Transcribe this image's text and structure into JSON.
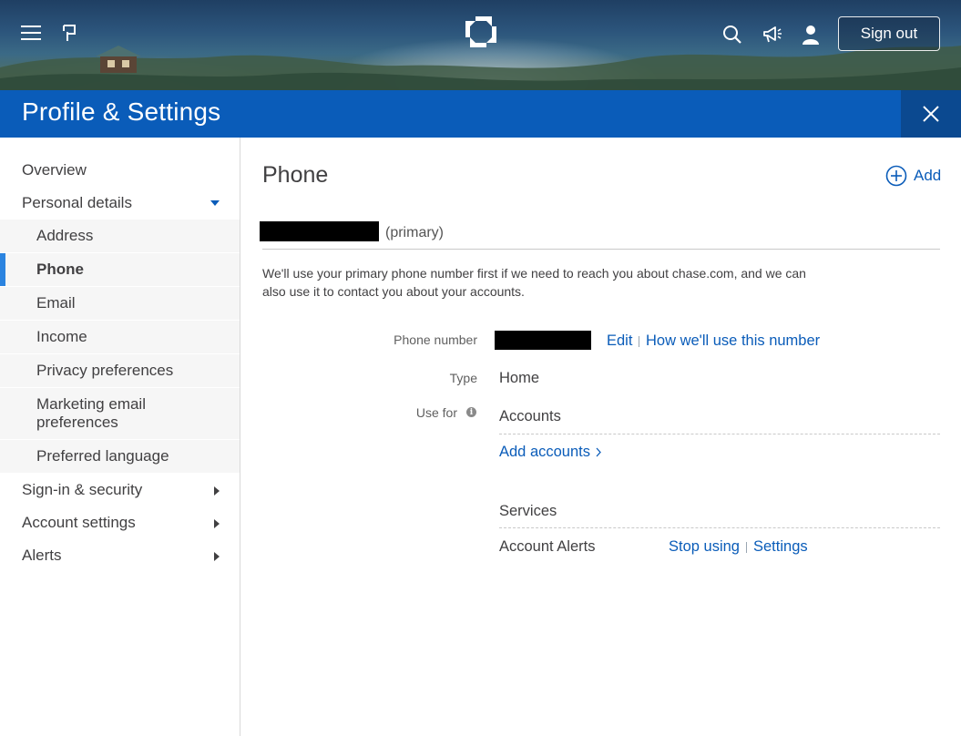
{
  "header": {
    "signout_label": "Sign out",
    "icons": [
      "menu-icon",
      "flag-icon",
      "chase-logo-icon",
      "search-icon",
      "megaphone-icon",
      "user-icon"
    ]
  },
  "titlebar": {
    "title": "Profile & Settings",
    "color": "#0a5cb9"
  },
  "sidebar": {
    "items": [
      {
        "label": "Overview"
      },
      {
        "label": "Personal details",
        "expanded": true
      },
      {
        "label": "Sign-in & security"
      },
      {
        "label": "Account settings"
      },
      {
        "label": "Alerts"
      }
    ],
    "subitems": [
      {
        "label": "Address"
      },
      {
        "label": "Phone",
        "active": true
      },
      {
        "label": "Email"
      },
      {
        "label": "Income"
      },
      {
        "label": "Privacy preferences"
      },
      {
        "label": "Marketing email preferences"
      },
      {
        "label": "Preferred language"
      }
    ]
  },
  "main": {
    "heading": "Phone",
    "add_label": "Add",
    "primary_tag": "(primary)",
    "description": "We'll use your primary phone number first if we need to reach you about chase.com, and we can also use it to contact you about your accounts.",
    "phone_number_label": "Phone number",
    "edit_label": "Edit",
    "how_use_label": "How we'll use this number",
    "type_label": "Type",
    "type_value": "Home",
    "use_for_label": "Use for",
    "accounts_value": "Accounts",
    "add_accounts_label": "Add accounts",
    "services_value": "Services",
    "account_alerts_value": "Account Alerts",
    "stop_using_label": "Stop using",
    "settings_label": "Settings"
  },
  "colors": {
    "accent": "#0a5cb9",
    "active_indicator": "#2b84e0",
    "redaction": "#000000"
  }
}
